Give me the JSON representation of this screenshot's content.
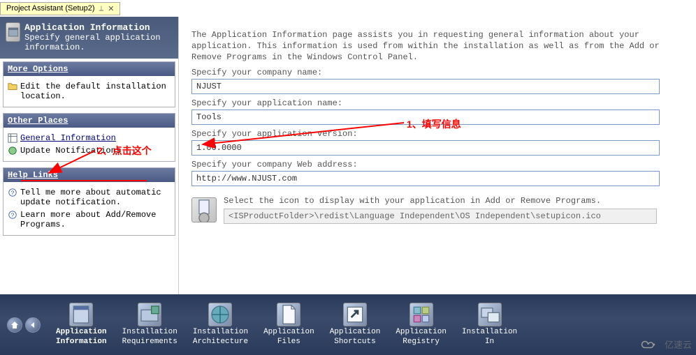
{
  "tab": {
    "title": "Project Assistant (Setup2)"
  },
  "banner": {
    "title": "Application Information",
    "subtitle": "Specify general application information."
  },
  "panels": {
    "more_options": {
      "header": "More Options",
      "items": [
        {
          "label": "Edit the default installation location."
        }
      ]
    },
    "other_places": {
      "header": "Other Places",
      "items": [
        {
          "label": "General Information"
        },
        {
          "label": "Update Notifications"
        }
      ]
    },
    "help_links": {
      "header": "Help Links",
      "items": [
        {
          "label": "Tell me more about automatic update notification."
        },
        {
          "label": "Learn more about Add/Remove Programs."
        }
      ]
    }
  },
  "form": {
    "intro": "The Application Information page assists you in requesting general information about your application. This information is used from within the installation as well as from the Add or Remove Programs in the Windows Control Panel.",
    "company_label": "Specify your company name:",
    "company_value": "NJUST",
    "appname_label": "Specify your application name:",
    "appname_value": "Tools",
    "version_label": "Specify your application version:",
    "version_value": "1.00.0000",
    "web_label": "Specify your company Web address:",
    "web_value": "http://www.NJUST.com",
    "icon_text": "Select the icon to display with your application in Add or Remove Programs.",
    "icon_path": "<ISProductFolder>\\redist\\Language Independent\\OS Independent\\setupicon.ico"
  },
  "nav": {
    "items": [
      "Application\nInformation",
      "Installation\nRequirements",
      "Installation\nArchitecture",
      "Application\nFiles",
      "Application\nShortcuts",
      "Application\nRegistry",
      "Installation\nIn"
    ]
  },
  "annotations": {
    "a1": "1、填写信息",
    "a2": "2、点击这个"
  },
  "watermark": "亿速云"
}
